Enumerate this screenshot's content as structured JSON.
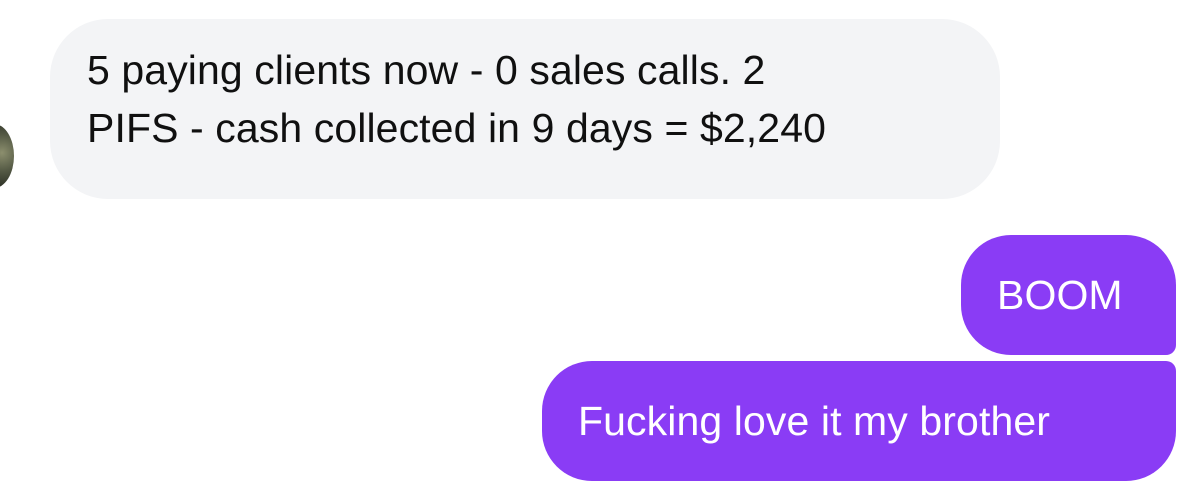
{
  "conversation": {
    "incoming_message": {
      "lines": [
        "5 paying clients now - 0 sales calls. 2",
        "PIFS - cash collected in 9 days = $2,240"
      ]
    },
    "outgoing_messages": [
      {
        "text": "BOOM"
      },
      {
        "text": "Fucking love it my brother"
      }
    ]
  },
  "colors": {
    "incoming_bubble": "#f3f4f6",
    "incoming_text": "#101010",
    "outgoing_bubble": "#8a3cf5",
    "outgoing_text": "#ffffff",
    "background": "#ffffff"
  }
}
